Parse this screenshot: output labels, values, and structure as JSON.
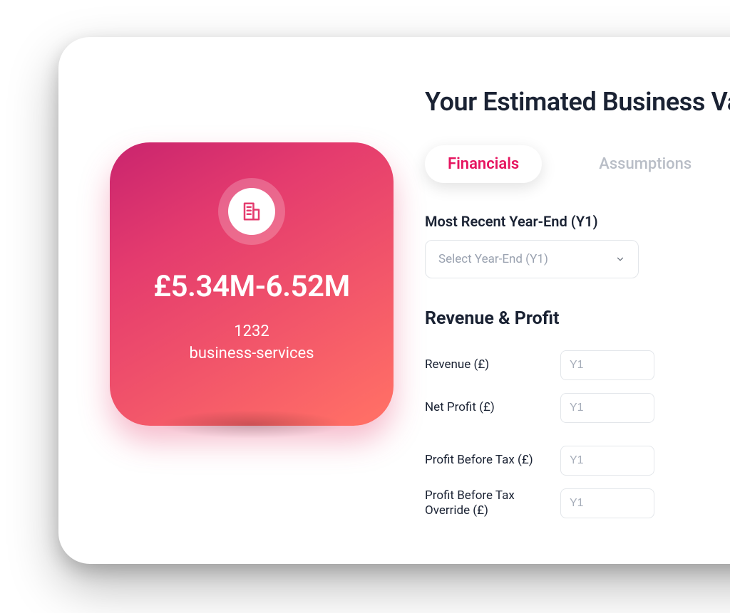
{
  "header": {
    "title": "Your Estimated Business Valuation"
  },
  "tabs": {
    "financials": "Financials",
    "assumptions": "Assumptions"
  },
  "valuation": {
    "range": "£5.34M-6.52M",
    "count": "1232",
    "category": "business-services"
  },
  "form": {
    "year_end_label": "Most Recent Year-End (Y1)",
    "year_end_placeholder": "Select Year-End (Y1)",
    "section_revenue_profit": "Revenue & Profit",
    "fields": {
      "revenue": {
        "label": "Revenue (£)",
        "placeholder": "Y1"
      },
      "net_profit": {
        "label": "Net Profit (£)",
        "placeholder": "Y1"
      },
      "pbt": {
        "label": "Profit Before Tax (£)",
        "placeholder": "Y1"
      },
      "pbt_override": {
        "label": "Profit Before Tax Override (£)",
        "placeholder": "Y1"
      }
    }
  }
}
